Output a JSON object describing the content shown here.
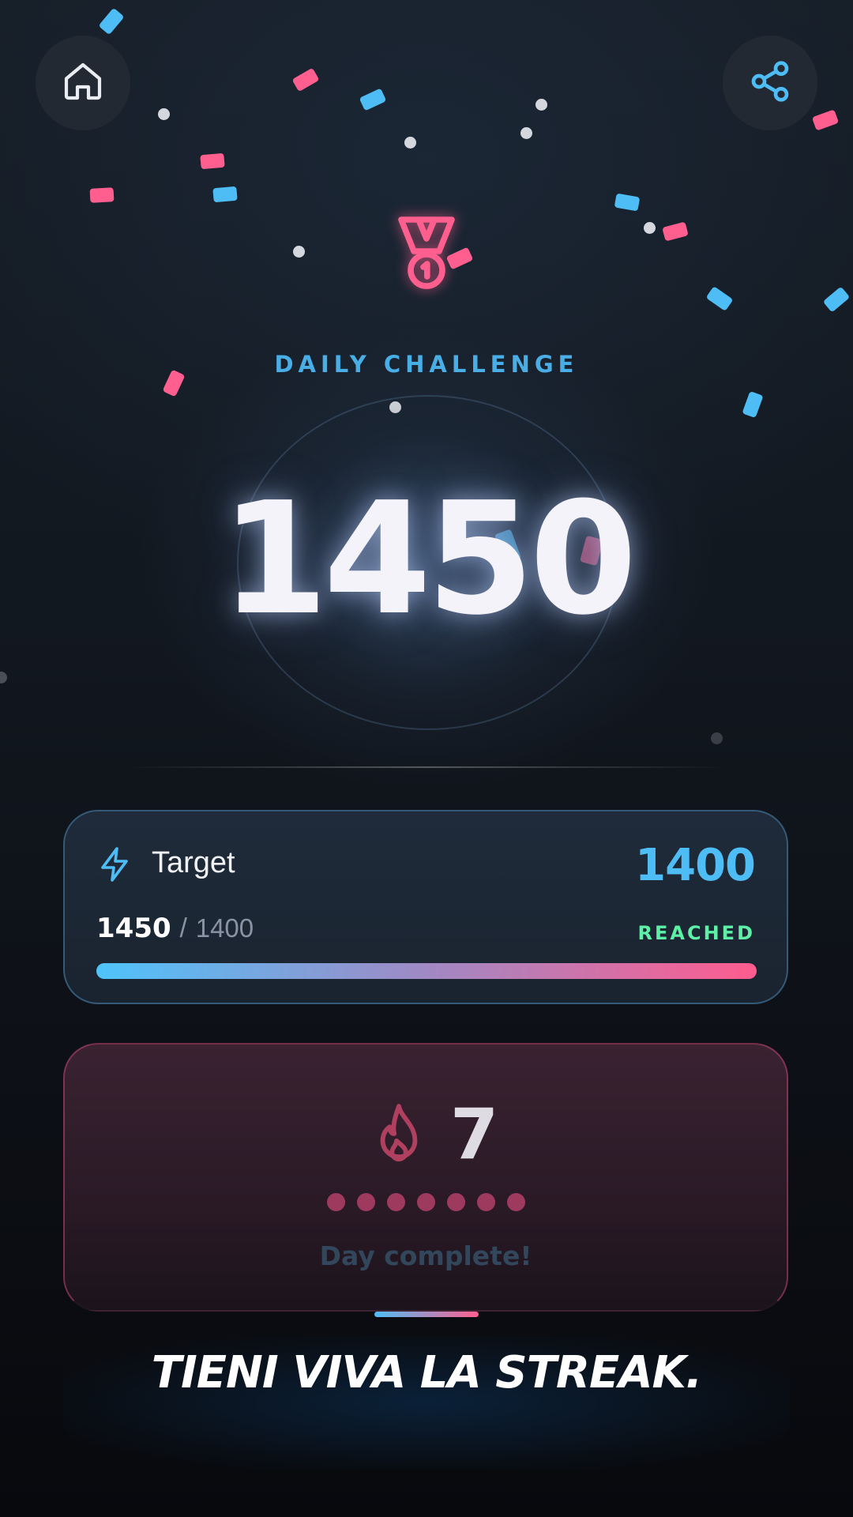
{
  "header": {
    "home_icon": "home-icon",
    "share_icon": "share-icon"
  },
  "hero": {
    "icon": "medal-icon",
    "label": "DAILY CHALLENGE",
    "score": "1450"
  },
  "target_card": {
    "icon": "lightning-icon",
    "title": "Target",
    "target_value": "1400",
    "current": "1450",
    "separator": "/",
    "target": "1400",
    "status": "REACHED",
    "progress_fraction": 1.0
  },
  "streak_card": {
    "icon": "flame-icon",
    "count": "7",
    "days_completed": 7,
    "message": "Day complete!"
  },
  "tagline": "TIENI VIVA LA STREAK.",
  "colors": {
    "accent_blue": "#4fbdf5",
    "accent_pink": "#ff5f8f",
    "success_green": "#5ff0a8"
  }
}
